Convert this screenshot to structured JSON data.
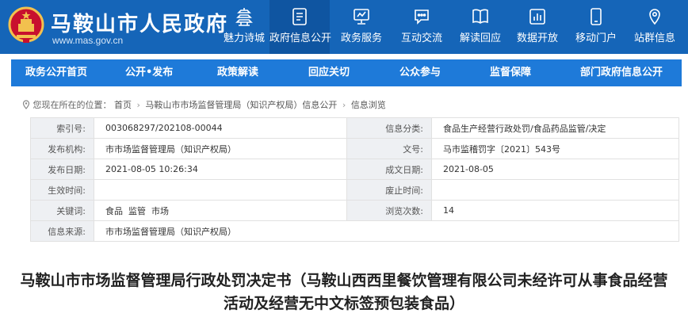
{
  "header": {
    "site_name": "马鞍山市人民政府",
    "site_url": "www.mas.gov.cn",
    "nav": [
      {
        "label": "魅力诗城",
        "icon": "pagoda-icon"
      },
      {
        "label": "政府信息公开",
        "icon": "document-list-icon",
        "active": true
      },
      {
        "label": "政务服务",
        "icon": "monitor-icon"
      },
      {
        "label": "互动交流",
        "icon": "chat-bubble-icon"
      },
      {
        "label": "解读回应",
        "icon": "book-icon"
      },
      {
        "label": "数据开放",
        "icon": "bar-chart-icon"
      },
      {
        "label": "移动门户",
        "icon": "mobile-icon"
      },
      {
        "label": "站群信息",
        "icon": "location-pin-icon"
      }
    ]
  },
  "subnav": [
    "政务公开首页",
    "公开•发布",
    "政策解读",
    "回应关切",
    "公众参与",
    "监督保障",
    "部门政府信息公开"
  ],
  "breadcrumb": {
    "prefix": "您现在所在的位置：",
    "items": [
      "首页",
      "马鞍山市市场监督管理局（知识产权局）信息公开",
      "信息浏览"
    ]
  },
  "info": {
    "index_no_label": "索引号:",
    "index_no": "003068297/202108-00044",
    "category_label": "信息分类:",
    "category": "食品生产经营行政处罚/食品药品监管/决定",
    "org_label": "发布机构:",
    "org": "市市场监督管理局（知识产权局）",
    "doc_no_label": "文号:",
    "doc_no": "马市监稽罚字〔2021〕543号",
    "publish_date_label": "发布日期:",
    "publish_date": "2021-08-05 10:26:34",
    "created_date_label": "成文日期:",
    "created_date": "2021-08-05",
    "effective_label": "生效时间:",
    "effective": "",
    "abolish_label": "废止时间:",
    "abolish": "",
    "keywords_label": "关键词:",
    "keywords": "食品  监管  市场",
    "views_label": "浏览次数:",
    "views": "14",
    "source_label": "信息来源:",
    "source": "市市场监督管理局（知识产权局）"
  },
  "document": {
    "title": "马鞍山市市场监督管理局行政处罚决定书（马鞍山西西里餐饮管理有限公司未经许可从事食品经营活动及经营无中文标签预包装食品）"
  },
  "colors": {
    "header_bg": "#1565b8",
    "nav_active_bg": "#0f55a1",
    "subnav_bg": "#1e7ad9",
    "label_bg": "#eef0f3"
  }
}
